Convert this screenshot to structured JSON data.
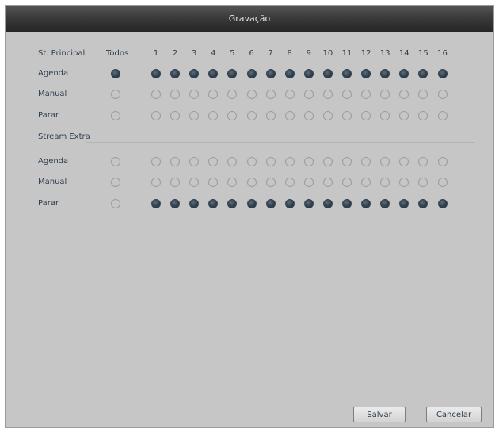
{
  "window": {
    "title": "Gravação"
  },
  "header": {
    "row_label": "St. Principal",
    "all_label": "Todos",
    "channels": [
      "1",
      "2",
      "3",
      "4",
      "5",
      "6",
      "7",
      "8",
      "9",
      "10",
      "11",
      "12",
      "13",
      "14",
      "15",
      "16"
    ]
  },
  "principal": {
    "rows": [
      {
        "label": "Agenda",
        "all_checked": true,
        "channels_checked": true
      },
      {
        "label": "Manual",
        "all_checked": false,
        "channels_checked": false
      },
      {
        "label": "Parar",
        "all_checked": false,
        "channels_checked": false
      }
    ]
  },
  "extra": {
    "section_label": "Stream Extra",
    "rows": [
      {
        "label": "Agenda",
        "all_checked": false,
        "channels_checked": false
      },
      {
        "label": "Manual",
        "all_checked": false,
        "channels_checked": false
      },
      {
        "label": "Parar",
        "all_checked": false,
        "channels_checked": true
      }
    ]
  },
  "footer": {
    "save_label": "Salvar",
    "cancel_label": "Cancelar"
  },
  "colors": {
    "panel_bg": "#c6c6c6",
    "radio_checked": "#33424f",
    "radio_unchecked_border": "#9c9c9c",
    "text": "#2f3e4f"
  }
}
